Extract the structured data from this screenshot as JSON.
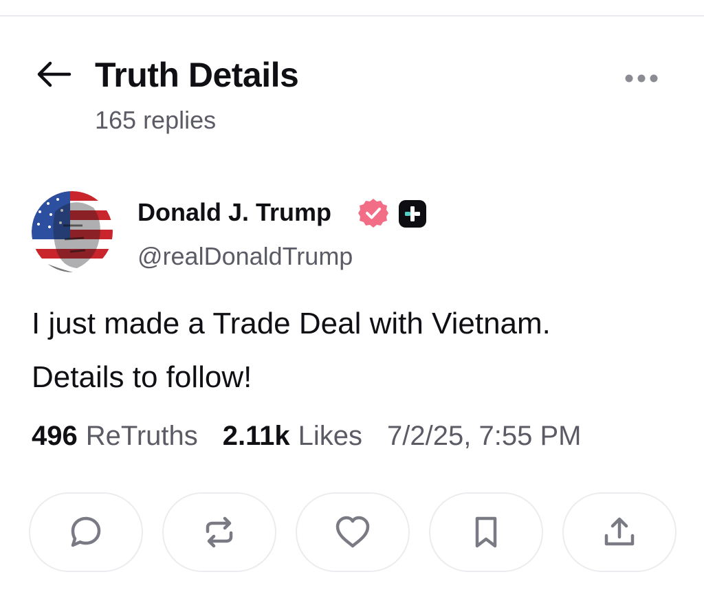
{
  "header": {
    "title": "Truth Details",
    "replies": "165 replies",
    "back_icon": "arrow-left-icon",
    "more_icon": "more-horizontal-icon"
  },
  "post": {
    "author": {
      "name": "Donald J. Trump",
      "handle": "@realDonaldTrump",
      "verified_badge_color": "#f26d86",
      "plus_badge_color": "#0d0d12"
    },
    "text_line1": "I just made a Trade Deal with Vietnam.",
    "text_line2": "Details to follow!",
    "stats": {
      "retruths_count": "496",
      "retruths_label": "ReTruths",
      "likes_count": "2.11k",
      "likes_label": "Likes",
      "timestamp": "7/2/25, 7:55 PM"
    }
  },
  "actions": [
    {
      "icon": "reply-icon"
    },
    {
      "icon": "retruth-icon"
    },
    {
      "icon": "like-heart-icon"
    },
    {
      "icon": "bookmark-icon"
    },
    {
      "icon": "share-icon"
    }
  ],
  "colors": {
    "text_primary": "#0f0f14",
    "text_secondary": "#5b5b66",
    "button_border": "#ececf0"
  }
}
